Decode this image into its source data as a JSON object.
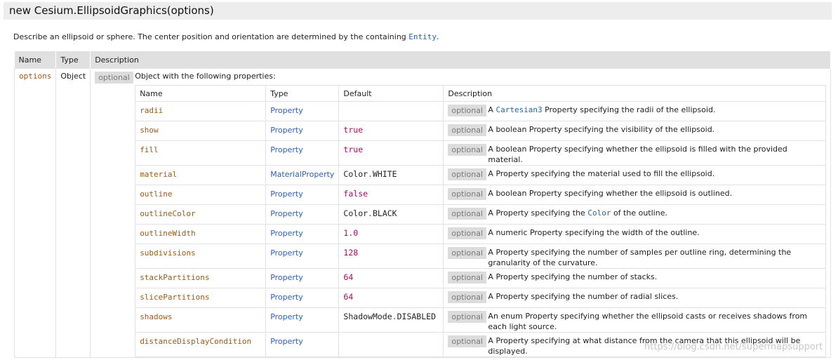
{
  "header": {
    "title": "new Cesium.EllipsoidGraphics(options)"
  },
  "description": {
    "before": "Describe an ellipsoid or sphere. The center position and orientation are determined by the containing ",
    "link": "Entity",
    "after": "."
  },
  "params_table": {
    "headers": [
      "Name",
      "Type",
      "Description"
    ],
    "param": {
      "name": "options",
      "type": "Object",
      "badge": "optional",
      "intro": "Object with the following properties:"
    }
  },
  "properties_table": {
    "headers": [
      "Name",
      "Type",
      "Default",
      "Description"
    ],
    "badge": "optional",
    "rows": [
      {
        "name": "radii",
        "type": "Property",
        "default": [],
        "desc": [
          {
            "t": "A "
          },
          {
            "t": "Cartesian3",
            "link": true
          },
          {
            "t": " Property specifying the radii of the ellipsoid."
          }
        ]
      },
      {
        "name": "show",
        "type": "Property",
        "default": [
          {
            "t": "true",
            "cls": "lit"
          }
        ],
        "desc": [
          {
            "t": "A boolean Property specifying the visibility of the ellipsoid."
          }
        ]
      },
      {
        "name": "fill",
        "type": "Property",
        "default": [
          {
            "t": "true",
            "cls": "lit"
          }
        ],
        "desc": [
          {
            "t": "A boolean Property specifying whether the ellipsoid is filled with the provided material."
          }
        ]
      },
      {
        "name": "material",
        "type": "MaterialProperty",
        "default": [
          {
            "t": "Color",
            "cls": "plain"
          },
          {
            "t": ".",
            "cls": "dot"
          },
          {
            "t": "WHITE",
            "cls": "plain"
          }
        ],
        "desc": [
          {
            "t": "A Property specifying the material used to fill the ellipsoid."
          }
        ]
      },
      {
        "name": "outline",
        "type": "Property",
        "default": [
          {
            "t": "false",
            "cls": "lit"
          }
        ],
        "desc": [
          {
            "t": "A boolean Property specifying whether the ellipsoid is outlined."
          }
        ]
      },
      {
        "name": "outlineColor",
        "type": "Property",
        "default": [
          {
            "t": "Color",
            "cls": "plain"
          },
          {
            "t": ".",
            "cls": "dot"
          },
          {
            "t": "BLACK",
            "cls": "plain"
          }
        ],
        "desc": [
          {
            "t": "A Property specifying the "
          },
          {
            "t": "Color",
            "link": true
          },
          {
            "t": " of the outline."
          }
        ]
      },
      {
        "name": "outlineWidth",
        "type": "Property",
        "default": [
          {
            "t": "1.0",
            "cls": "lit"
          }
        ],
        "desc": [
          {
            "t": "A numeric Property specifying the width of the outline."
          }
        ]
      },
      {
        "name": "subdivisions",
        "type": "Property",
        "default": [
          {
            "t": "128",
            "cls": "lit"
          }
        ],
        "desc": [
          {
            "t": "A Property specifying the number of samples per outline ring, determining the granularity of the curvature."
          }
        ]
      },
      {
        "name": "stackPartitions",
        "type": "Property",
        "default": [
          {
            "t": "64",
            "cls": "lit"
          }
        ],
        "desc": [
          {
            "t": "A Property specifying the number of stacks."
          }
        ]
      },
      {
        "name": "slicePartitions",
        "type": "Property",
        "default": [
          {
            "t": "64",
            "cls": "lit"
          }
        ],
        "desc": [
          {
            "t": "A Property specifying the number of radial slices."
          }
        ]
      },
      {
        "name": "shadows",
        "type": "Property",
        "default": [
          {
            "t": "ShadowMode",
            "cls": "plain"
          },
          {
            "t": ".",
            "cls": "dot"
          },
          {
            "t": "DISABLED",
            "cls": "plain"
          }
        ],
        "desc": [
          {
            "t": "An enum Property specifying whether the ellipsoid casts or receives shadows from each light source."
          }
        ]
      },
      {
        "name": "distanceDisplayCondition",
        "type": "Property",
        "default": [],
        "desc": [
          {
            "t": "A Property specifying at what distance from the camera that this ellipsoid will be displayed."
          }
        ]
      }
    ]
  },
  "watermark": "https://blog.csdn.net/supermapsupport",
  "colors": {
    "header_bg": "#ededed",
    "link": "#2366a8",
    "param_name": "#9a5b17",
    "literal": "#a01060",
    "badge_bg": "#dcdcdc"
  }
}
